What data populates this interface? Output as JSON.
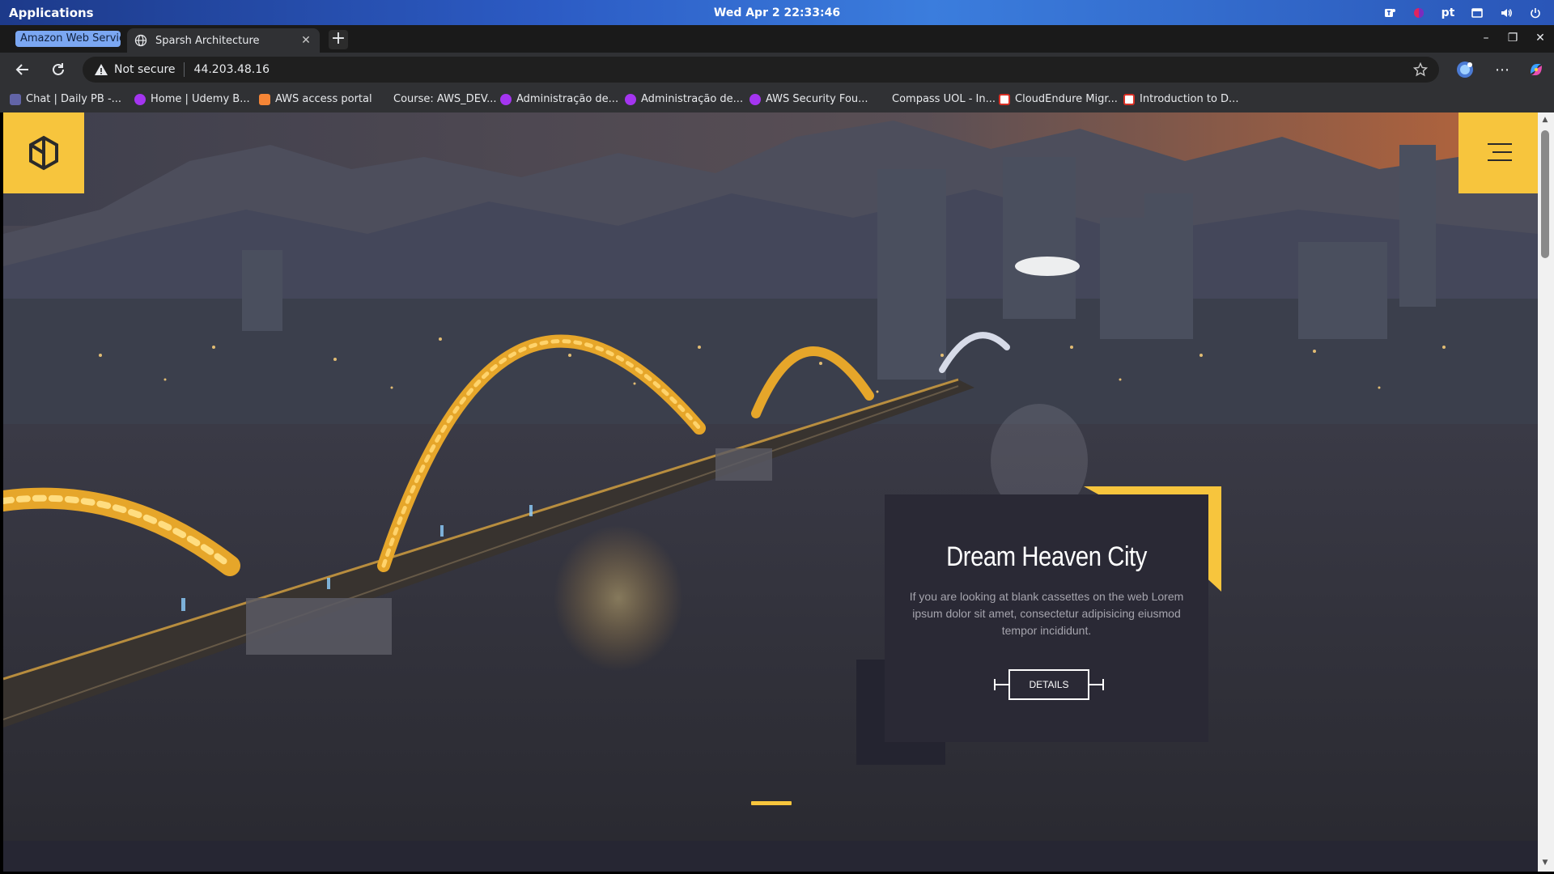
{
  "system": {
    "applications_label": "Applications",
    "clock": "Wed Apr 2  22:33:46",
    "keyboard_layout": "pt"
  },
  "browser": {
    "tab_group_label": "Amazon Web Servic",
    "active_tab_title": "Sparsh Architecture",
    "address": {
      "security_label": "Not secure",
      "url": "44.203.48.16"
    },
    "bookmarks": [
      {
        "label": "Chat | Daily PB -...",
        "icon": "teams-icon",
        "color": "#6264a7"
      },
      {
        "label": "Home | Udemy B...",
        "icon": "udemy-icon",
        "color": "#a435f0"
      },
      {
        "label": "AWS access portal",
        "icon": "aws-icon",
        "color": "#f58536"
      },
      {
        "label": "Course: AWS_DEV...",
        "icon": "none",
        "color": "#303134"
      },
      {
        "label": "Administração de...",
        "icon": "udemy-icon",
        "color": "#a435f0"
      },
      {
        "label": "Administração de...",
        "icon": "udemy-icon",
        "color": "#a435f0"
      },
      {
        "label": "AWS Security Fou...",
        "icon": "udemy-icon",
        "color": "#a435f0"
      },
      {
        "label": "Compass UOL - In...",
        "icon": "none",
        "color": "#303134"
      },
      {
        "label": "CloudEndure Migr...",
        "icon": "gmail-icon",
        "color": "#ffffff"
      },
      {
        "label": "Introduction to D...",
        "icon": "gmail-icon",
        "color": "#ffffff"
      }
    ]
  },
  "page": {
    "brand_color": "#f7c53d",
    "card": {
      "title": "Dream Heaven City",
      "text": "If you are looking at blank cassettes on the web Lorem ipsum dolor sit amet, consectetur adipisicing eiusmod tempor incididunt.",
      "button_label": "DETAILS"
    }
  }
}
